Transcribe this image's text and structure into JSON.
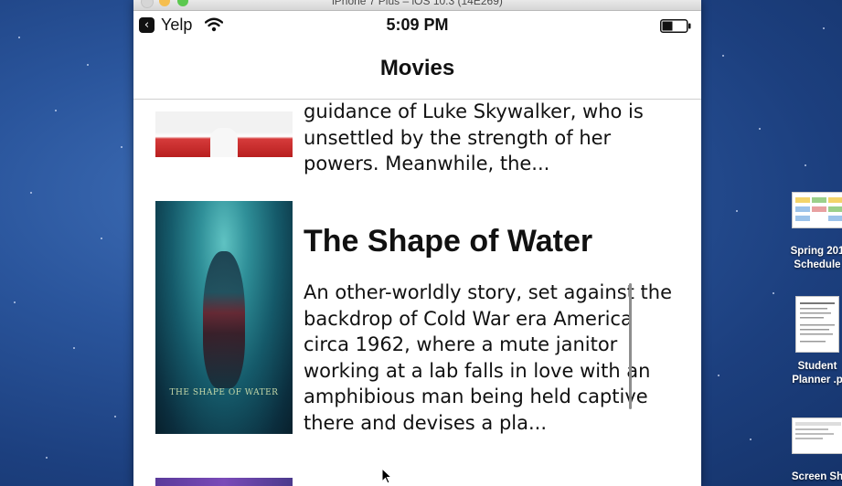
{
  "simulator": {
    "window_title": "iPhone 7 Plus – iOS 10.3 (14E269)"
  },
  "status_bar": {
    "back_app": "Yelp",
    "time": "5:09 PM"
  },
  "nav": {
    "title": "Movies"
  },
  "movies": {
    "previous_overview_tail": "guidance of Luke Skywalker, who is unsettled by the strength of her powers. Meanwhile, the...",
    "current": {
      "title": "The Shape of Water",
      "overview": "An other-worldly story, set against the backdrop of Cold War era America circa 1962, where a mute janitor working at a lab falls in love with an amphibious man being held captive there and devises a pla...",
      "poster_caption": "THE SHAPE OF WATER"
    }
  },
  "desktop_icons": [
    {
      "label": "Spring 201 Schedule",
      "icon": "spreadsheet-icon"
    },
    {
      "label": "Student Planner .p",
      "icon": "pdf-document-icon"
    },
    {
      "label": "Screen Sh",
      "icon": "screenshot-icon"
    }
  ]
}
